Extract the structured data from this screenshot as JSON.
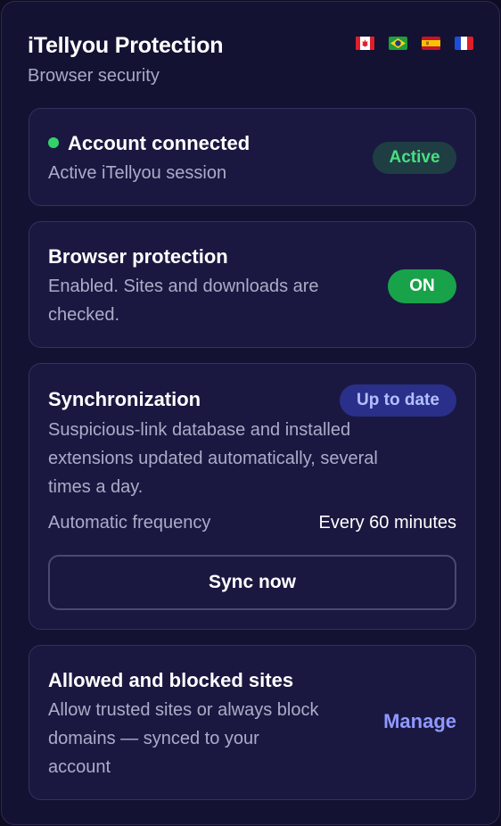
{
  "header": {
    "title": "iTellyou Protection",
    "subtitle": "Browser security",
    "languages": [
      "canada-flag-icon",
      "brazil-flag-icon",
      "spain-flag-icon",
      "france-flag-icon"
    ]
  },
  "account": {
    "title": "Account connected",
    "text": "Active iTellyou session",
    "badge": "Active"
  },
  "protection": {
    "title": "Browser protection",
    "text_line1": "Enabled. Sites and downloads are",
    "text_line2": "checked.",
    "toggle": "ON"
  },
  "sync": {
    "title": "Synchronization",
    "badge": "Up to date",
    "text_line1": "Suspicious-link database and installed",
    "text_line2": "extensions updated automatically, several",
    "text_line3": "times a day.",
    "frequency_label": "Automatic frequency",
    "frequency_value": "Every 60 minutes",
    "button": "Sync now"
  },
  "sites": {
    "title": "Allowed and blocked sites",
    "text_line1": "Allow trusted sites or always block",
    "text_line2": "domains — synced to your",
    "text_line3": "account",
    "link": "Manage"
  },
  "colors": {
    "background": "#141232",
    "card": "#1a1840",
    "success": "#34d36a",
    "toggle_on": "#18a34a",
    "accent_link": "#8f98ff"
  }
}
